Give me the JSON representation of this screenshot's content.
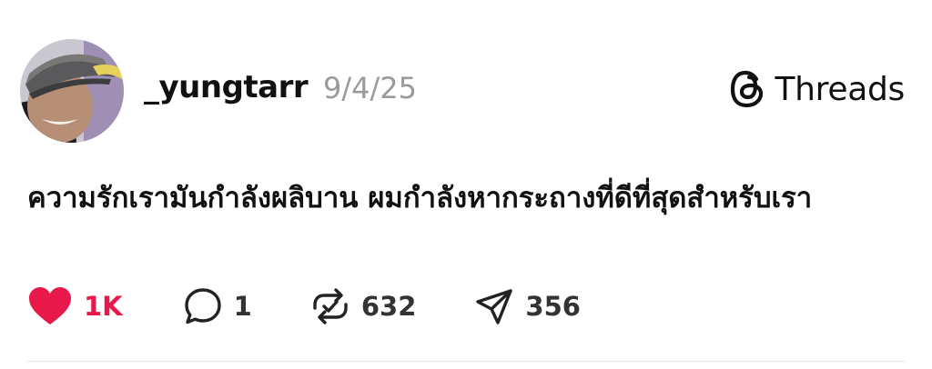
{
  "post": {
    "username": "_yungtarr",
    "date": "9/4/25",
    "text": "ความรักเรามันกำลังผลิบาน ผมกำลังหากระถางที่ดีที่สุดสำหรับเรา"
  },
  "brand": {
    "label": "Threads",
    "icon": "threads-logo-icon"
  },
  "actions": {
    "likes": "1K",
    "comments": "1",
    "reposts": "632",
    "shares": "356"
  },
  "colors": {
    "like": "#e8194a",
    "date": "#9a9a9a",
    "text": "#111111"
  }
}
